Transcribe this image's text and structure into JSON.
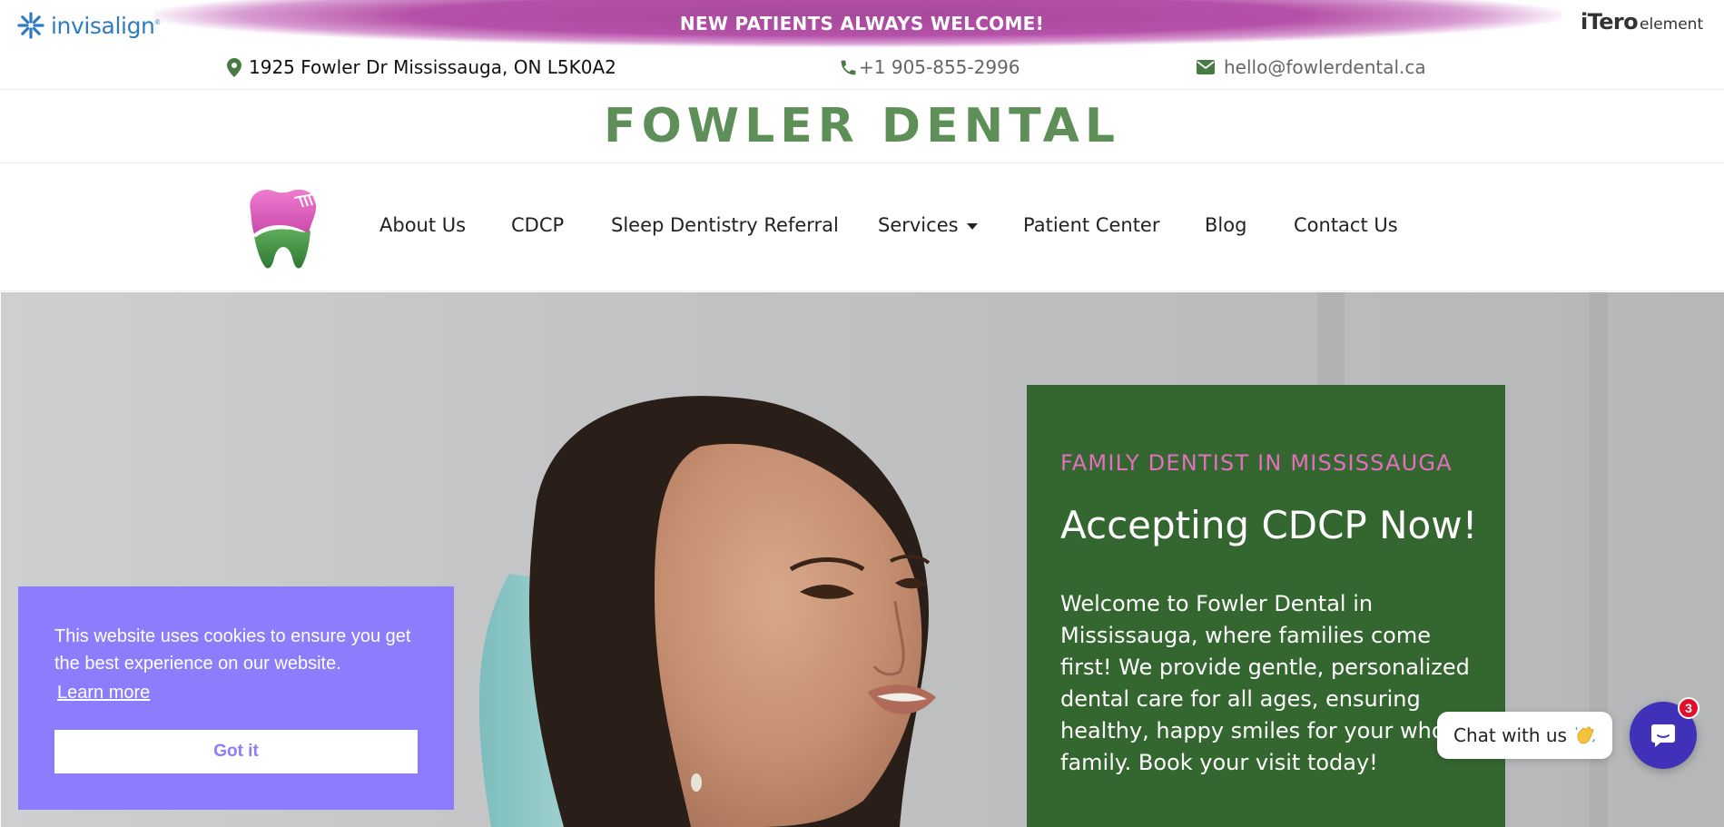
{
  "banner": {
    "text": "NEW PATIENTS ALWAYS WELCOME!",
    "left_brand": "invisalign",
    "right_brand_main": "iTero",
    "right_brand_sub": "element",
    "accent_color": "#b550a8"
  },
  "contact": {
    "address": "1925 Fowler Dr Mississauga, ON L5K0A2",
    "phone": "+1 905-855-2996",
    "email": "hello@fowlerdental.ca",
    "icon_color": "#4a7a44"
  },
  "site": {
    "title": "FOWLER DENTAL",
    "title_color": "#5f8f58"
  },
  "nav": {
    "items": [
      {
        "label": "About Us"
      },
      {
        "label": "CDCP"
      },
      {
        "label": "Sleep Dentistry Referral"
      },
      {
        "label": "Services",
        "has_dropdown": true
      },
      {
        "label": "Patient Center"
      },
      {
        "label": "Blog"
      },
      {
        "label": "Contact Us"
      }
    ]
  },
  "hero": {
    "eyebrow": "FAMILY DENTIST IN MISSISSAUGA",
    "heading": "Accepting CDCP Now!",
    "body": "Welcome to Fowler Dental in Mississauga, where families come first! We provide gentle, personalized dental care for all ages, ensuring healthy, happy smiles for your whole family. Book your visit today!",
    "card_color": "#346630",
    "eyebrow_color": "#e36fbf"
  },
  "cookie": {
    "message": "This website uses cookies to ensure you get the best experience on our website.",
    "link": "Learn more",
    "button": "Got it",
    "color": "#8d7cfb"
  },
  "chat": {
    "label": "Chat with us",
    "badge_count": "3",
    "color": "#3f31b8"
  },
  "icons": [
    "invisalign-star-icon",
    "map-pin-icon",
    "phone-icon",
    "envelope-icon",
    "tooth-logo-icon",
    "caret-down-icon",
    "waving-hand-icon",
    "chat-icon"
  ]
}
